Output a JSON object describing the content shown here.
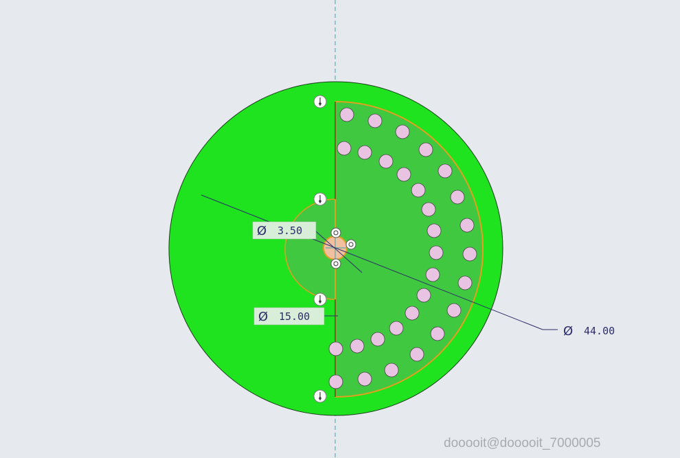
{
  "dimensions": {
    "small_hole": {
      "symbol": "Ø",
      "value": "3.50"
    },
    "inner_arc": {
      "symbol": "Ø",
      "value": "15.00"
    },
    "outer_disc": {
      "symbol": "Ø",
      "value": "44.00"
    }
  },
  "watermark": "dooooit@dooooit_7000005",
  "colors": {
    "background": "#e6e9ee",
    "disc_fill": "#1ee31e",
    "sector_fill": "#40c840",
    "edge_highlight": "#e0a020",
    "hole_fill": "#e8c4e2",
    "dimension": "#2c2c6a",
    "centerline": "#3aa6a6"
  }
}
